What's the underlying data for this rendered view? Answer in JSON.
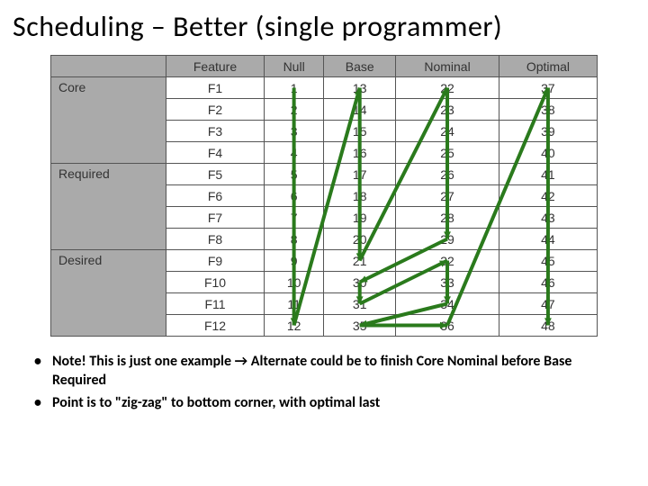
{
  "title": "Scheduling – Better (single programmer)",
  "columns": [
    "",
    "Feature",
    "Null",
    "Base",
    "Nominal",
    "Optimal"
  ],
  "categories": [
    {
      "label": "Core",
      "span": 4
    },
    {
      "label": "Required",
      "span": 4
    },
    {
      "label": "Desired",
      "span": 4
    }
  ],
  "rows": [
    {
      "feature": "F1",
      "null": 1,
      "base": 13,
      "nominal": 22,
      "optimal": 37
    },
    {
      "feature": "F2",
      "null": 2,
      "base": 14,
      "nominal": 23,
      "optimal": 38
    },
    {
      "feature": "F3",
      "null": 3,
      "base": 15,
      "nominal": 24,
      "optimal": 39
    },
    {
      "feature": "F4",
      "null": 4,
      "base": 16,
      "nominal": 25,
      "optimal": 40
    },
    {
      "feature": "F5",
      "null": 5,
      "base": 17,
      "nominal": 26,
      "optimal": 41
    },
    {
      "feature": "F6",
      "null": 6,
      "base": 18,
      "nominal": 27,
      "optimal": 42
    },
    {
      "feature": "F7",
      "null": 7,
      "base": 19,
      "nominal": 28,
      "optimal": 43
    },
    {
      "feature": "F8",
      "null": 8,
      "base": 20,
      "nominal": 29,
      "optimal": 44
    },
    {
      "feature": "F9",
      "null": 9,
      "base": 21,
      "nominal": 32,
      "optimal": 45
    },
    {
      "feature": "F10",
      "null": 10,
      "base": 30,
      "nominal": 33,
      "optimal": 46
    },
    {
      "feature": "F11",
      "null": 11,
      "base": 31,
      "nominal": 34,
      "optimal": 47
    },
    {
      "feature": "F12",
      "null": 12,
      "base": 35,
      "nominal": 36,
      "optimal": 48
    }
  ],
  "notes": [
    "Note!  This is just one example → Alternate could be to finish Core Nominal before Base Required",
    "Point is to \"zig-zag\" to bottom corner, with optimal last"
  ],
  "chart_data": {
    "type": "table",
    "title": "Scheduling – Better (single programmer)",
    "categories": [
      "Core",
      "Core",
      "Core",
      "Core",
      "Required",
      "Required",
      "Required",
      "Required",
      "Desired",
      "Desired",
      "Desired",
      "Desired"
    ],
    "series": [
      {
        "name": "Feature",
        "values": [
          "F1",
          "F2",
          "F3",
          "F4",
          "F5",
          "F6",
          "F7",
          "F8",
          "F9",
          "F10",
          "F11",
          "F12"
        ]
      },
      {
        "name": "Null",
        "values": [
          1,
          2,
          3,
          4,
          5,
          6,
          7,
          8,
          9,
          10,
          11,
          12
        ]
      },
      {
        "name": "Base",
        "values": [
          13,
          14,
          15,
          16,
          17,
          18,
          19,
          20,
          21,
          30,
          31,
          35
        ]
      },
      {
        "name": "Nominal",
        "values": [
          22,
          23,
          24,
          25,
          26,
          27,
          28,
          29,
          32,
          33,
          34,
          36
        ]
      },
      {
        "name": "Optimal",
        "values": [
          37,
          38,
          39,
          40,
          41,
          42,
          43,
          44,
          45,
          46,
          47,
          48
        ]
      }
    ]
  }
}
